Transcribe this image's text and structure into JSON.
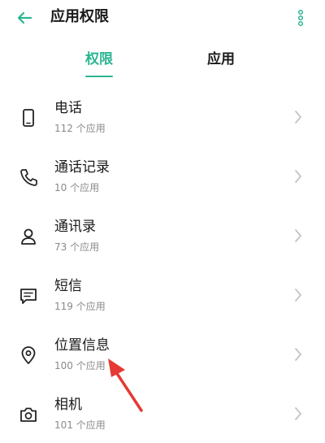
{
  "header": {
    "title": "应用权限",
    "back_icon": "back-arrow-icon",
    "more_icon": "more-vertical-icon",
    "accent_color": "#2bb592"
  },
  "tabs": [
    {
      "label": "权限",
      "active": true
    },
    {
      "label": "应用",
      "active": false
    }
  ],
  "permissions": [
    {
      "icon": "phone-icon",
      "title": "电话",
      "count": "112 个应用"
    },
    {
      "icon": "call-log-icon",
      "title": "通话记录",
      "count": "10 个应用"
    },
    {
      "icon": "contacts-icon",
      "title": "通讯录",
      "count": "73 个应用"
    },
    {
      "icon": "sms-icon",
      "title": "短信",
      "count": "119 个应用"
    },
    {
      "icon": "location-icon",
      "title": "位置信息",
      "count": "100 个应用"
    },
    {
      "icon": "camera-icon",
      "title": "相机",
      "count": "101 个应用"
    }
  ],
  "annotation": {
    "icon": "red-arrow-annotation",
    "color": "#e53935"
  }
}
